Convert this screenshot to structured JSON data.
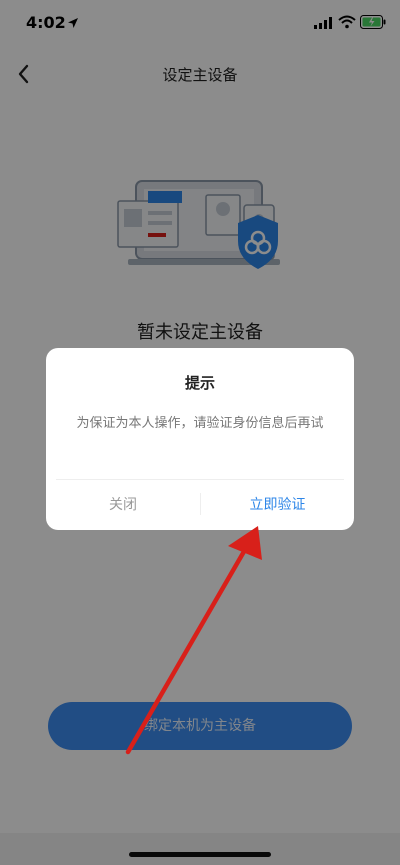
{
  "status_bar": {
    "time": "4:02"
  },
  "nav": {
    "title": "设定主设备"
  },
  "main": {
    "empty_title": "暂未设定主设备",
    "bind_button_label": "绑定本机为主设备"
  },
  "dialog": {
    "title": "提示",
    "message": "为保证为本人操作，请验证身份信息后再试",
    "close_label": "关闭",
    "verify_label": "立即验证"
  },
  "colors": {
    "accent": "#2d86e8",
    "button_bg": "#3d8df0",
    "annotation_arrow": "#d8201a"
  },
  "icons": [
    "location-arrow-icon",
    "signal-icon",
    "wifi-icon",
    "battery-icon",
    "back-icon",
    "shield-cloud-icon"
  ]
}
